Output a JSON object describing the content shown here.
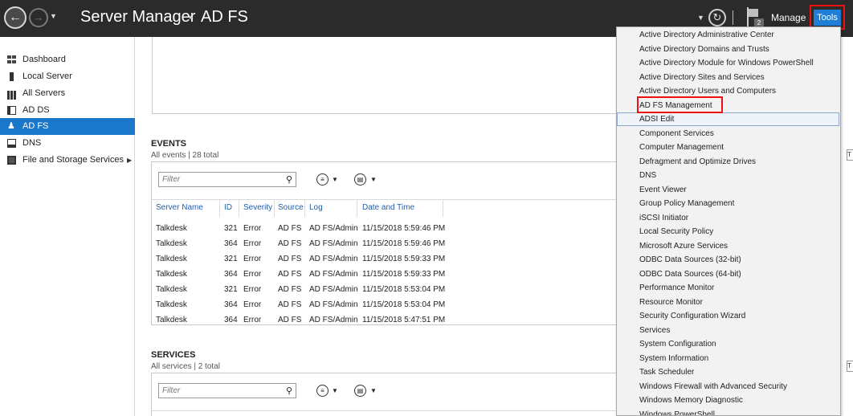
{
  "titlebar": {
    "app": "Server Manager",
    "separator": "▸",
    "page": "AD FS",
    "manage": "Manage",
    "tools": "Tools",
    "notification_count": "2"
  },
  "sidebar": {
    "items": [
      {
        "label": "Dashboard",
        "icon": "dashboard-icon"
      },
      {
        "label": "Local Server",
        "icon": "server-icon"
      },
      {
        "label": "All Servers",
        "icon": "servers-icon"
      },
      {
        "label": "AD DS",
        "icon": "adds-icon"
      },
      {
        "label": "AD FS",
        "icon": "adfs-icon"
      },
      {
        "label": "DNS",
        "icon": "dns-icon"
      },
      {
        "label": "File and Storage Services",
        "icon": "storage-icon"
      }
    ],
    "active_index": 4
  },
  "events": {
    "title": "EVENTS",
    "subtitle": "All events | 28 total",
    "filter_placeholder": "Filter",
    "columns": [
      "Server Name",
      "ID",
      "Severity",
      "Source",
      "Log",
      "Date and Time"
    ],
    "rows": [
      [
        "Talkdesk",
        "321",
        "Error",
        "AD FS",
        "AD FS/Admin",
        "11/15/2018 5:59:46 PM"
      ],
      [
        "Talkdesk",
        "364",
        "Error",
        "AD FS",
        "AD FS/Admin",
        "11/15/2018 5:59:46 PM"
      ],
      [
        "Talkdesk",
        "321",
        "Error",
        "AD FS",
        "AD FS/Admin",
        "11/15/2018 5:59:33 PM"
      ],
      [
        "Talkdesk",
        "364",
        "Error",
        "AD FS",
        "AD FS/Admin",
        "11/15/2018 5:59:33 PM"
      ],
      [
        "Talkdesk",
        "321",
        "Error",
        "AD FS",
        "AD FS/Admin",
        "11/15/2018 5:53:04 PM"
      ],
      [
        "Talkdesk",
        "364",
        "Error",
        "AD FS",
        "AD FS/Admin",
        "11/15/2018 5:53:04 PM"
      ],
      [
        "Talkdesk",
        "364",
        "Error",
        "AD FS",
        "AD FS/Admin",
        "11/15/2018 5:47:51 PM"
      ]
    ]
  },
  "services": {
    "title": "SERVICES",
    "subtitle": "All services | 2 total",
    "filter_placeholder": "Filter"
  },
  "tools_menu": {
    "items": [
      "Active Directory Administrative Center",
      "Active Directory Domains and Trusts",
      "Active Directory Module for Windows PowerShell",
      "Active Directory Sites and Services",
      "Active Directory Users and Computers",
      "AD FS Management",
      "ADSI Edit",
      "Component Services",
      "Computer Management",
      "Defragment and Optimize Drives",
      "DNS",
      "Event Viewer",
      "Group Policy Management",
      "iSCSI Initiator",
      "Local Security Policy",
      "Microsoft Azure Services",
      "ODBC Data Sources (32-bit)",
      "ODBC Data Sources (64-bit)",
      "Performance Monitor",
      "Resource Monitor",
      "Security Configuration Wizard",
      "Services",
      "System Configuration",
      "System Information",
      "Task Scheduler",
      "Windows Firewall with Advanced Security",
      "Windows Memory Diagnostic",
      "Windows PowerShell"
    ],
    "highlighted": "AD FS Management",
    "hovered": "ADSI Edit"
  },
  "colors": {
    "titlebar": "#2b2b2b",
    "accent": "#1a77c9",
    "highlight_box": "#ee1111"
  }
}
